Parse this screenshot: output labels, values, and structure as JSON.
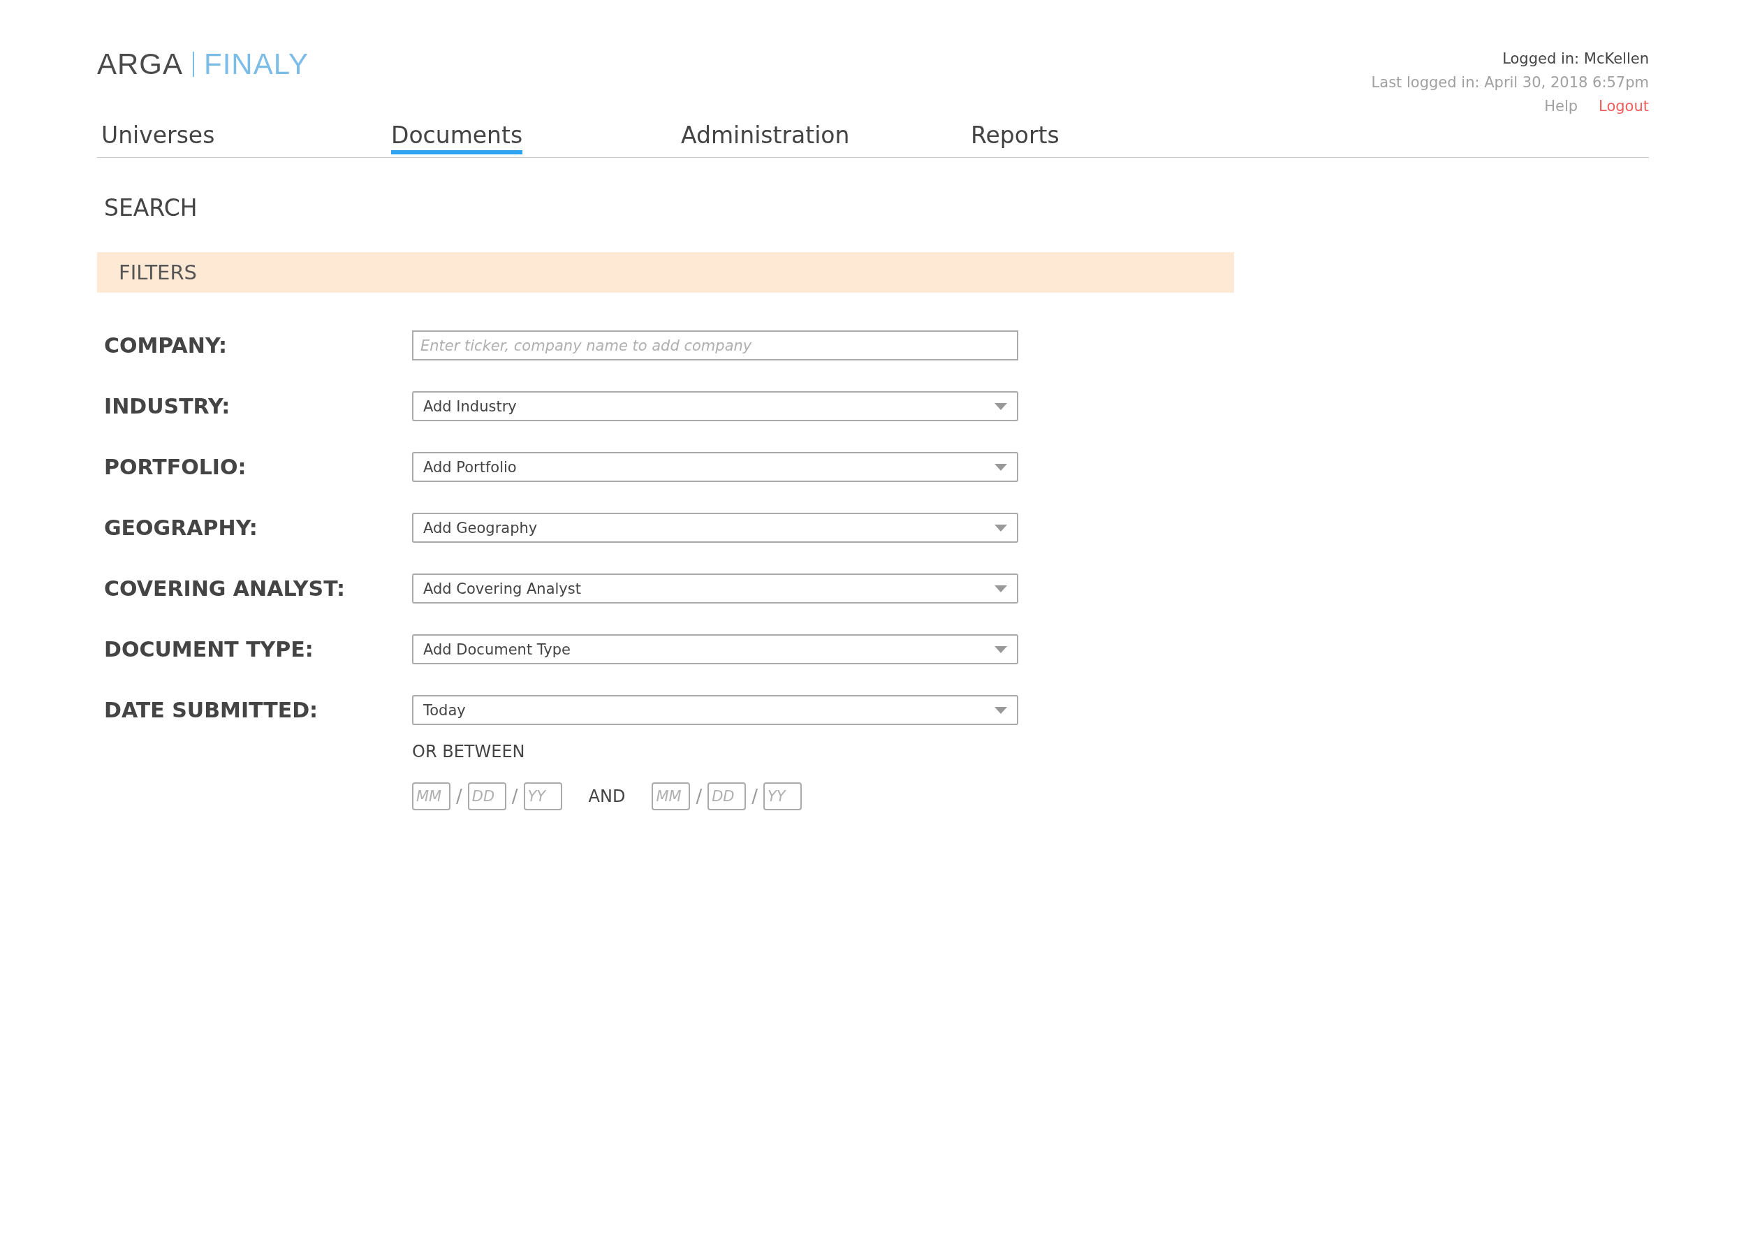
{
  "logo": {
    "left": "ARGA",
    "right": "FINALY"
  },
  "user": {
    "logged_in": "Logged in: McKellen",
    "last_login": "Last logged in: April 30, 2018 6:57pm",
    "links": [
      {
        "label": "Help",
        "kind": "plain"
      },
      {
        "label": "Logout",
        "kind": "danger"
      }
    ]
  },
  "tabs": [
    {
      "label": "Universes",
      "selected": false
    },
    {
      "label": "Documents",
      "selected": true
    },
    {
      "label": "Administration",
      "selected": false
    },
    {
      "label": "Reports",
      "selected": false
    }
  ],
  "page_title": "SEARCH",
  "filters": {
    "title": "FILTERS",
    "fields": [
      {
        "label": "COMPANY:",
        "kind": "text",
        "placeholder": "Enter ticker, company name to add company"
      },
      {
        "label": "INDUSTRY:",
        "kind": "select",
        "value": "Add Industry"
      },
      {
        "label": "PORTFOLIO:",
        "kind": "select",
        "value": "Add Portfolio"
      },
      {
        "label": "GEOGRAPHY:",
        "kind": "select",
        "value": "Add Geography"
      },
      {
        "label": "COVERING ANALYST:",
        "kind": "select",
        "value": "Add Covering Analyst"
      },
      {
        "label": "DOCUMENT TYPE:",
        "kind": "select",
        "value": "Add Document Type"
      },
      {
        "label": "DATE SUBMITTED:",
        "kind": "select",
        "value": "Today"
      }
    ],
    "range": {
      "label": "OR BETWEEN",
      "joiner": "AND",
      "start": [
        {
          "placeholder": "MM"
        },
        {
          "placeholder": "DD"
        },
        {
          "placeholder": "YY"
        }
      ],
      "end": [
        {
          "placeholder": "MM"
        },
        {
          "placeholder": "DD"
        },
        {
          "placeholder": "YY"
        }
      ],
      "separator": "/"
    }
  }
}
